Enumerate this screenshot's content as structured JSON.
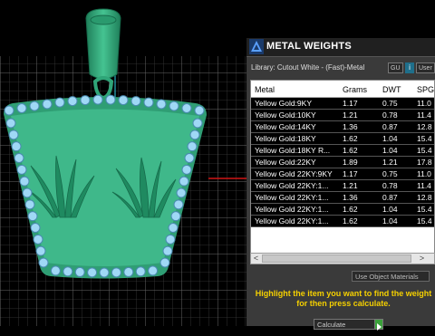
{
  "panel": {
    "title": "METAL WEIGHTS",
    "library_text": "Library: Cutout White - (Fast)-Metal",
    "gu_label": "GU",
    "info_label": "i",
    "user_label": "User",
    "columns": [
      "Metal",
      "Grams",
      "DWT",
      "SPG"
    ],
    "rows": [
      {
        "metal": "Yellow Gold:9KY",
        "grams": "1.17",
        "dwt": "0.75",
        "spg": "11.0"
      },
      {
        "metal": "Yellow Gold:10KY",
        "grams": "1.21",
        "dwt": "0.78",
        "spg": "11.4"
      },
      {
        "metal": "Yellow Gold:14KY",
        "grams": "1.36",
        "dwt": "0.87",
        "spg": "12.8"
      },
      {
        "metal": "Yellow Gold:18KY",
        "grams": "1.62",
        "dwt": "1.04",
        "spg": "15.4"
      },
      {
        "metal": "Yellow Gold:18KY R...",
        "grams": "1.62",
        "dwt": "1.04",
        "spg": "15.4"
      },
      {
        "metal": "Yellow Gold:22KY",
        "grams": "1.89",
        "dwt": "1.21",
        "spg": "17.8"
      },
      {
        "metal": "Yellow Gold 22KY:9KY",
        "grams": "1.17",
        "dwt": "0.75",
        "spg": "11.0"
      },
      {
        "metal": "Yellow Gold 22KY:1...",
        "grams": "1.21",
        "dwt": "0.78",
        "spg": "11.4"
      },
      {
        "metal": "Yellow Gold 22KY:1...",
        "grams": "1.36",
        "dwt": "0.87",
        "spg": "12.8"
      },
      {
        "metal": "Yellow Gold 22KY:1...",
        "grams": "1.62",
        "dwt": "1.04",
        "spg": "15.4"
      },
      {
        "metal": "Yellow Gold 22KY:1...",
        "grams": "1.62",
        "dwt": "1.04",
        "spg": "15.4"
      }
    ],
    "scroll_left": "<",
    "scroll_right": ">",
    "material_select": "Use Object Materials",
    "hint_text": "Highlight the item you want to find the weight for then press calculate.",
    "calculate_label": "Calculate"
  },
  "colors": {
    "pendant": "#3fb88a",
    "pendant_dark": "#1f7f5a",
    "gem": "#9fd8f5",
    "grid": "#555555",
    "hint": "#f5d000"
  }
}
